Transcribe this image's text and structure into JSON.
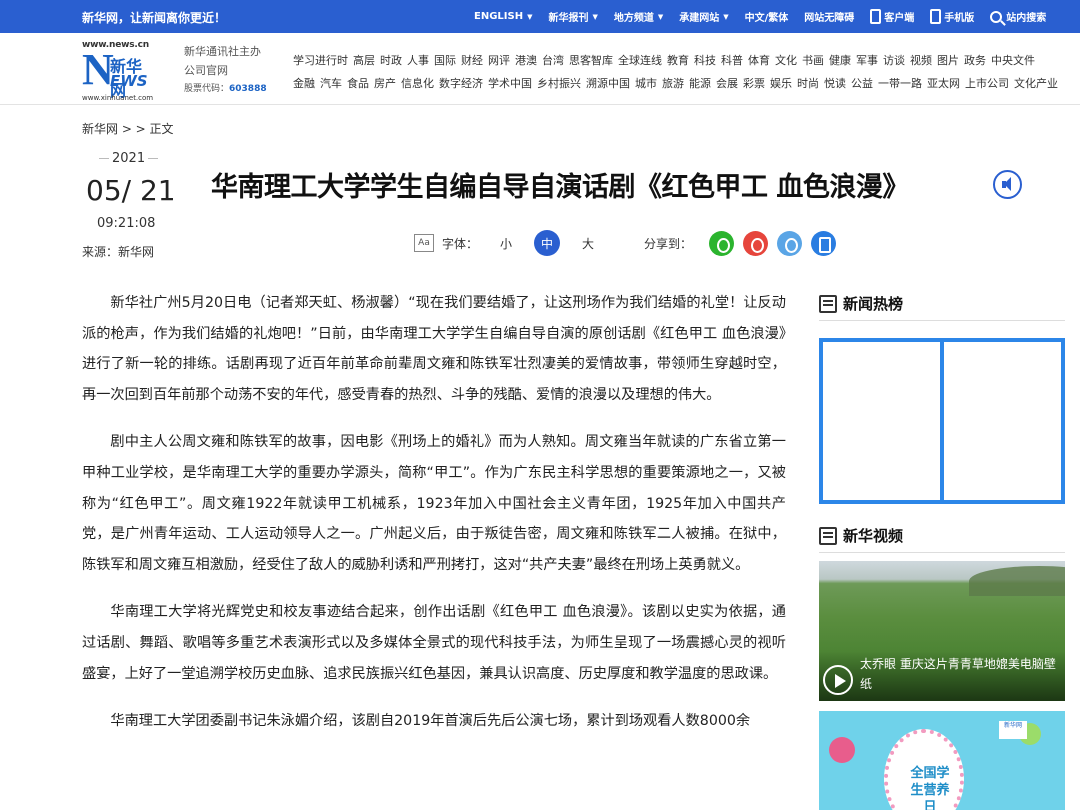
{
  "topbar": {
    "slogan": "新华网，让新闻离你更近！",
    "nav": [
      {
        "label": "ENGLISH",
        "caret": true
      },
      {
        "label": "新华报刊",
        "caret": true
      },
      {
        "label": "地方频道",
        "caret": true
      },
      {
        "label": "承建网站",
        "caret": true
      },
      {
        "label": "中文/繁体",
        "caret": false
      },
      {
        "label": "网站无障碍",
        "caret": false
      },
      {
        "label": "客户端",
        "icon": "phone-icon"
      },
      {
        "label": "手机版",
        "icon": "mobile-icon"
      },
      {
        "label": "站内搜索",
        "icon": "search-icon"
      }
    ]
  },
  "logo": {
    "url": "www.news.cn",
    "n": "N",
    "cn": "新华网",
    "ews": "EWS",
    "bottom": "www.xinhuanet.com"
  },
  "official": {
    "line1": "新华通讯社主办",
    "line2": "公司官网",
    "stock_label": "股票代码：",
    "stock_code": "603888"
  },
  "menu": {
    "row1": [
      "学习进行时",
      "高层",
      "时政",
      "人事",
      "国际",
      "财经",
      "网评",
      "港澳",
      "台湾",
      "思客智库",
      "全球连线",
      "教育",
      "科技",
      "科普",
      "体育",
      "文化",
      "书画",
      "健康",
      "军事",
      "访谈",
      "视频",
      "图片",
      "政务",
      "中央文件"
    ],
    "row2": [
      "金融",
      "汽车",
      "食品",
      "房产",
      "信息化",
      "数字经济",
      "学术中国",
      "乡村振兴",
      "溯源中国",
      "城市",
      "旅游",
      "能源",
      "会展",
      "彩票",
      "娱乐",
      "时尚",
      "悦读",
      "公益",
      "一带一路",
      "亚太网",
      "上市公司",
      "文化产业"
    ]
  },
  "breadcrumb": "新华网 > > 正文",
  "date": {
    "year": "2021",
    "day": "05/ 21",
    "time": "09:21:08"
  },
  "source": "来源：新华网",
  "title": "华南理工大学学生自编自导自演话剧《红色甲工 血色浪漫》",
  "toolbar": {
    "font_icon": "Aa",
    "font_label": "字体：",
    "small": "小",
    "medium": "中",
    "large": "大",
    "share_label": "分享到："
  },
  "article": [
    "新华社广州5月20日电（记者郑天虹、杨淑馨）“现在我们要结婚了，让这刑场作为我们结婚的礼堂！让反动派的枪声，作为我们结婚的礼炮吧！”日前，由华南理工大学学生自编自导自演的原创话剧《红色甲工 血色浪漫》进行了新一轮的排练。话剧再现了近百年前革命前辈周文雍和陈铁军壮烈凄美的爱情故事，带领师生穿越时空，再一次回到百年前那个动荡不安的年代，感受青春的热烈、斗争的残酷、爱情的浪漫以及理想的伟大。",
    "剧中主人公周文雍和陈铁军的故事，因电影《刑场上的婚礼》而为人熟知。周文雍当年就读的广东省立第一甲种工业学校，是华南理工大学的重要办学源头，简称“甲工”。作为广东民主科学思想的重要策源地之一，又被称为“红色甲工”。周文雍1922年就读甲工机械系，1923年加入中国社会主义青年团，1925年加入中国共产党，是广州青年运动、工人运动领导人之一。广州起义后，由于叛徒告密，周文雍和陈铁军二人被捕。在狱中，陈铁军和周文雍互相激励，经受住了敌人的威胁利诱和严刑拷打，这对“共产夫妻”最终在刑场上英勇就义。",
    "华南理工大学将光辉党史和校友事迹结合起来，创作出话剧《红色甲工 血色浪漫》。该剧以史实为依据，通过话剧、舞蹈、歌唱等多重艺术表演形式以及多媒体全景式的现代科技手法，为师生呈现了一场震撼心灵的视听盛宴，上好了一堂追溯学校历史血脉、追求民族振兴红色基因，兼具认识高度、历史厚度和教学温度的思政课。",
    "华南理工大学团委副书记朱泳媚介绍，该剧自2019年首演后先后公演七场，累计到场观看人数8000余"
  ],
  "sidebar": {
    "hot_title": "新闻热榜",
    "video_title": "新华视频",
    "video_caption": "太乔眼 重庆这片青青草地媲美电脑壁纸",
    "banner_text": "全国学生营养日",
    "banner_tag": "新华网"
  }
}
